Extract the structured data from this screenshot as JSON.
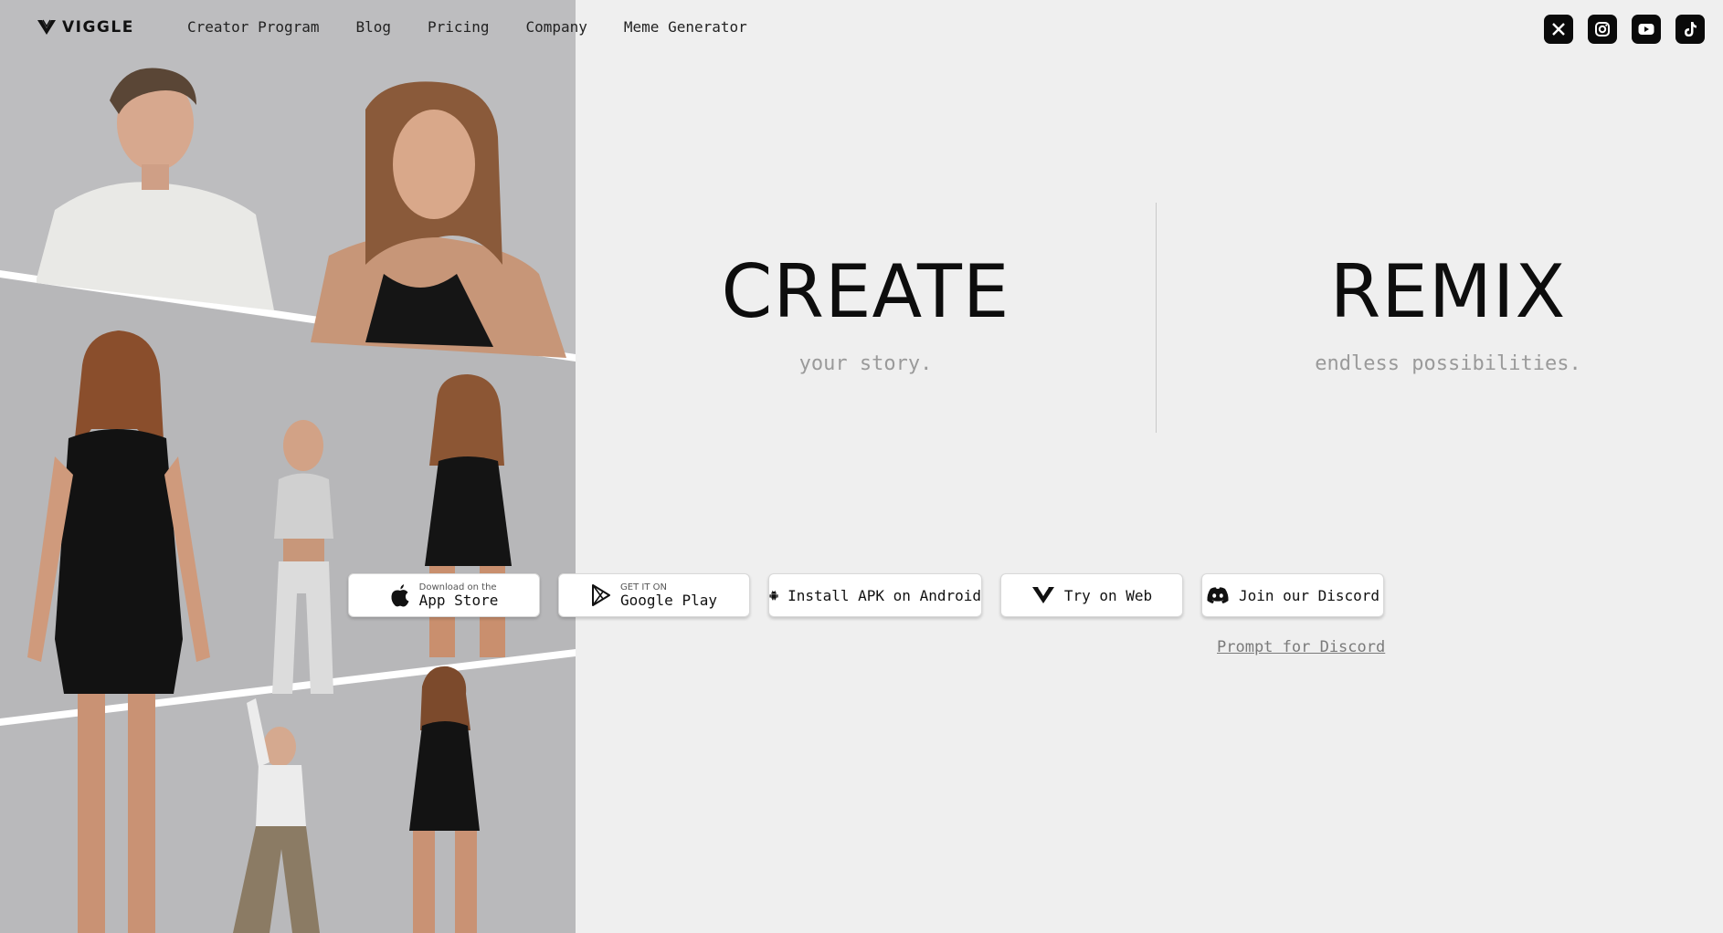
{
  "brand": {
    "name": "VIGGLE"
  },
  "nav": {
    "links": [
      "Creator Program",
      "Blog",
      "Pricing",
      "Company",
      "Meme Generator"
    ]
  },
  "socials": [
    {
      "name": "x-icon",
      "glyph": "X"
    },
    {
      "name": "instagram-icon",
      "glyph": ""
    },
    {
      "name": "youtube-icon",
      "glyph": ""
    },
    {
      "name": "tiktok-icon",
      "glyph": "♪"
    }
  ],
  "hero": {
    "create_title": "CREATE",
    "create_sub": "your story.",
    "remix_title": "REMIX",
    "remix_sub": "endless possibilities."
  },
  "buttons": {
    "app_store_small": "Download on the",
    "app_store_big": "App Store",
    "google_play_small": "GET IT ON",
    "google_play_big": "Google Play",
    "apk": "Install APK on Android",
    "web": "Try on Web",
    "discord": "Join our Discord"
  },
  "prompt_link": "Prompt for Discord",
  "colors": {
    "background": "#efefef",
    "panel": "#b9b9bb",
    "button_bg": "#ffffff",
    "text": "#111111"
  }
}
